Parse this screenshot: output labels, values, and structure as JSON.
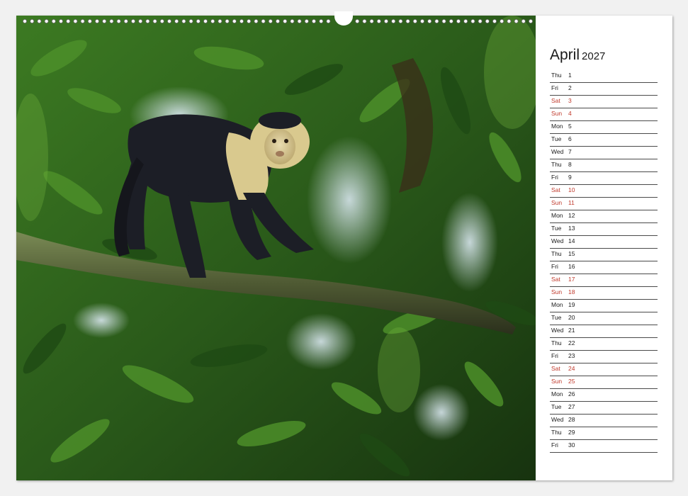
{
  "calendar": {
    "month": "April",
    "year": "2027",
    "weekend_color": "#c0392b",
    "days": [
      {
        "dow": "Thu",
        "day": "1",
        "weekend": false
      },
      {
        "dow": "Fri",
        "day": "2",
        "weekend": false
      },
      {
        "dow": "Sat",
        "day": "3",
        "weekend": true
      },
      {
        "dow": "Sun",
        "day": "4",
        "weekend": true
      },
      {
        "dow": "Mon",
        "day": "5",
        "weekend": false
      },
      {
        "dow": "Tue",
        "day": "6",
        "weekend": false
      },
      {
        "dow": "Wed",
        "day": "7",
        "weekend": false
      },
      {
        "dow": "Thu",
        "day": "8",
        "weekend": false
      },
      {
        "dow": "Fri",
        "day": "9",
        "weekend": false
      },
      {
        "dow": "Sat",
        "day": "10",
        "weekend": true
      },
      {
        "dow": "Sun",
        "day": "11",
        "weekend": true
      },
      {
        "dow": "Mon",
        "day": "12",
        "weekend": false
      },
      {
        "dow": "Tue",
        "day": "13",
        "weekend": false
      },
      {
        "dow": "Wed",
        "day": "14",
        "weekend": false
      },
      {
        "dow": "Thu",
        "day": "15",
        "weekend": false
      },
      {
        "dow": "Fri",
        "day": "16",
        "weekend": false
      },
      {
        "dow": "Sat",
        "day": "17",
        "weekend": true
      },
      {
        "dow": "Sun",
        "day": "18",
        "weekend": true
      },
      {
        "dow": "Mon",
        "day": "19",
        "weekend": false
      },
      {
        "dow": "Tue",
        "day": "20",
        "weekend": false
      },
      {
        "dow": "Wed",
        "day": "21",
        "weekend": false
      },
      {
        "dow": "Thu",
        "day": "22",
        "weekend": false
      },
      {
        "dow": "Fri",
        "day": "23",
        "weekend": false
      },
      {
        "dow": "Sat",
        "day": "24",
        "weekend": true
      },
      {
        "dow": "Sun",
        "day": "25",
        "weekend": true
      },
      {
        "dow": "Mon",
        "day": "26",
        "weekend": false
      },
      {
        "dow": "Tue",
        "day": "27",
        "weekend": false
      },
      {
        "dow": "Wed",
        "day": "28",
        "weekend": false
      },
      {
        "dow": "Thu",
        "day": "29",
        "weekend": false
      },
      {
        "dow": "Fri",
        "day": "30",
        "weekend": false
      }
    ]
  },
  "photo": {
    "subject": "white-faced-capuchin-monkey",
    "foliage_color": "#2f6a1e",
    "fur_dark": "#1c1e26",
    "fur_light": "#d9c98e"
  }
}
